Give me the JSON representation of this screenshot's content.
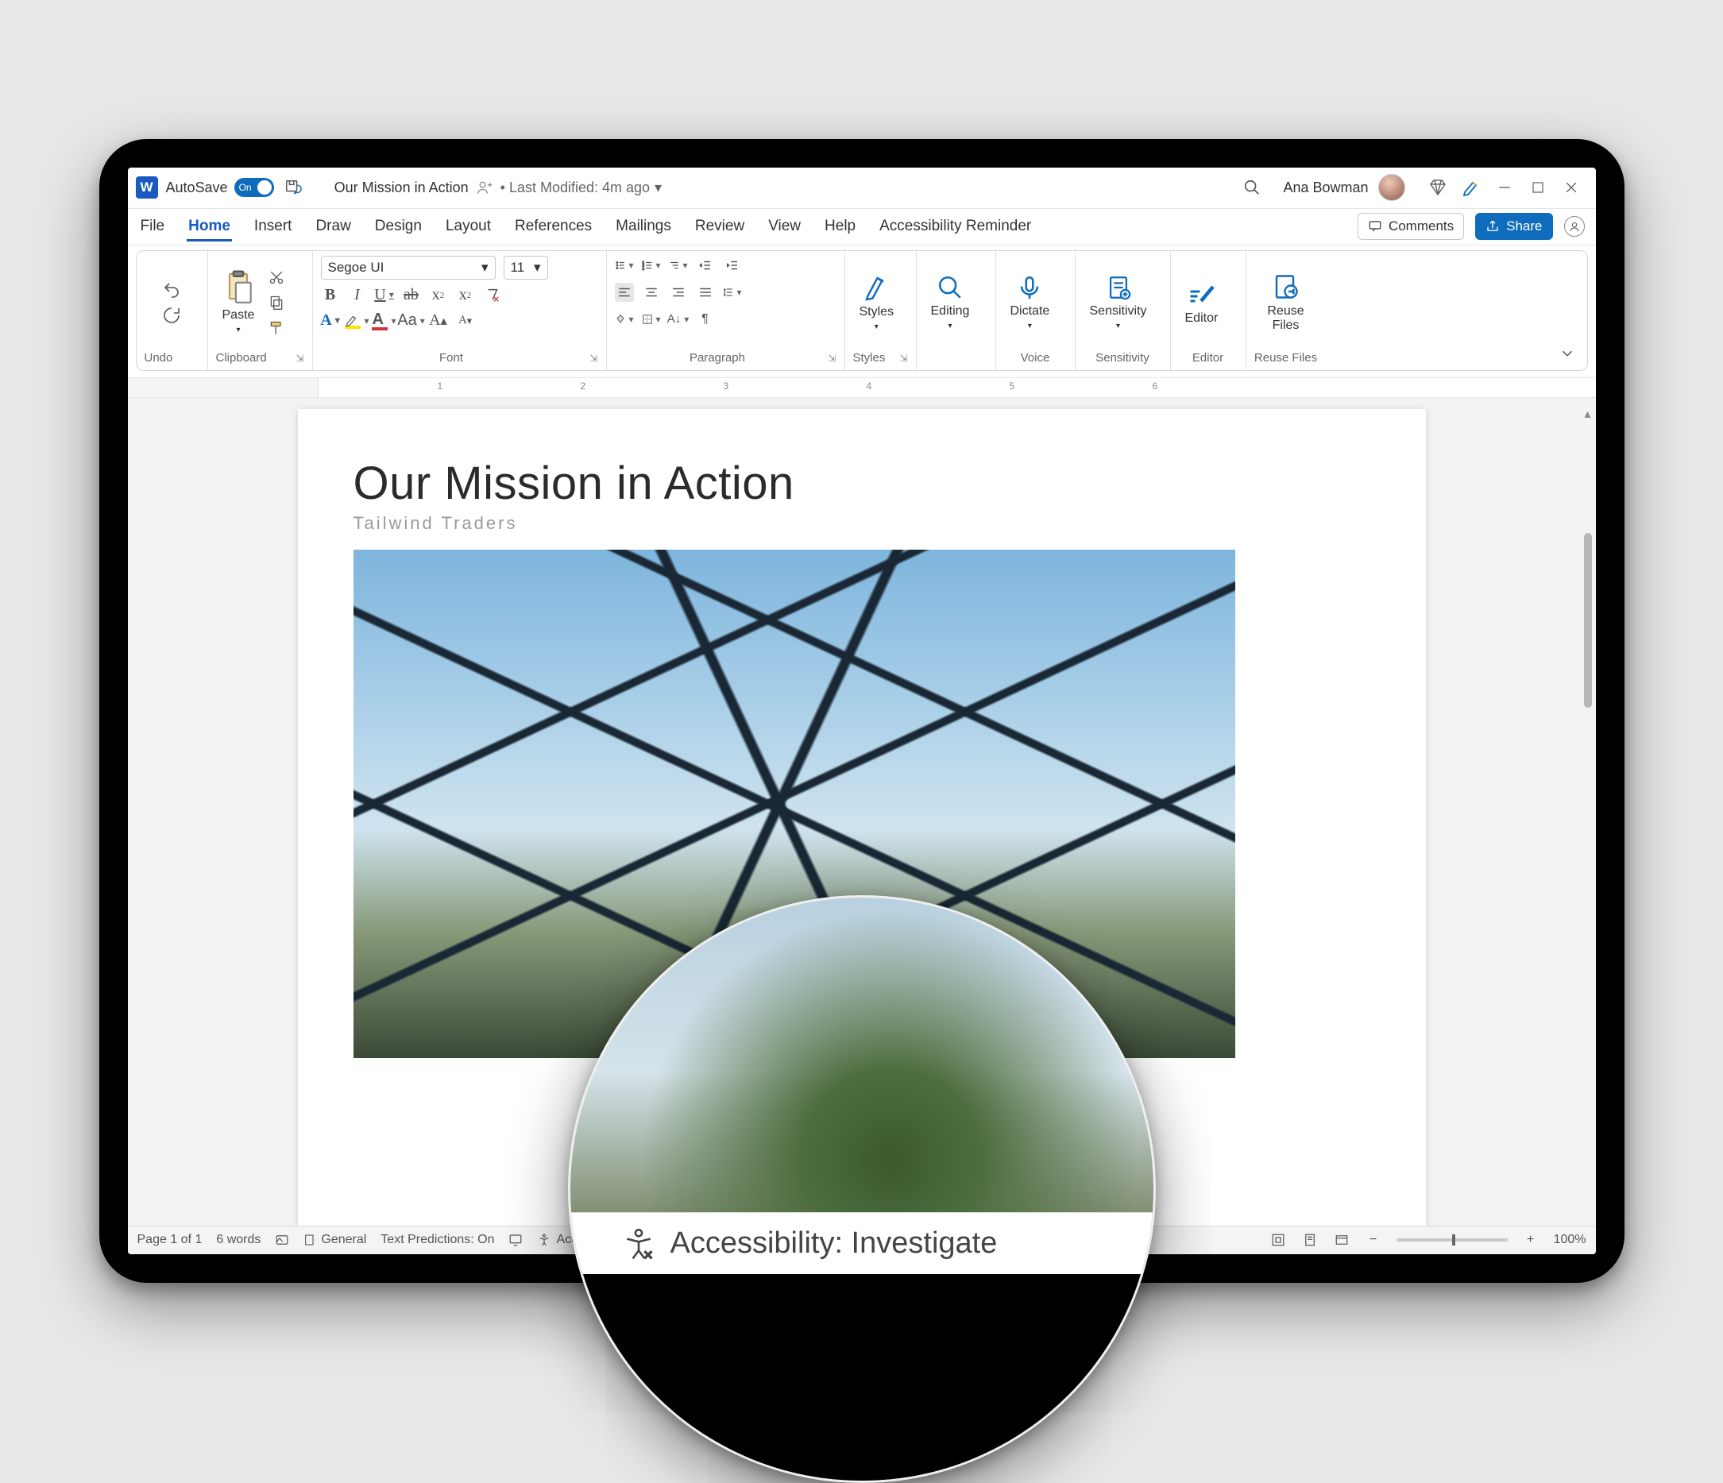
{
  "titlebar": {
    "autosave_label": "AutoSave",
    "autosave_state": "On",
    "doc_title": "Our Mission in Action",
    "last_modified": "• Last Modified: 4m ago",
    "user_name": "Ana Bowman"
  },
  "tabs": {
    "file": "File",
    "home": "Home",
    "insert": "Insert",
    "draw": "Draw",
    "design": "Design",
    "layout": "Layout",
    "references": "References",
    "mailings": "Mailings",
    "review": "Review",
    "view": "View",
    "help": "Help",
    "accessibility_reminder": "Accessibility Reminder",
    "comments": "Comments",
    "share": "Share"
  },
  "ribbon": {
    "undo_group": "Undo",
    "clipboard_group": "Clipboard",
    "paste": "Paste",
    "font_group": "Font",
    "font_name": "Segoe UI",
    "font_size": "11",
    "paragraph_group": "Paragraph",
    "styles_group": "Styles",
    "styles": "Styles",
    "editing": "Editing",
    "voice_group": "Voice",
    "dictate": "Dictate",
    "sensitivity_group": "Sensitivity",
    "sensitivity": "Sensitivity",
    "editor_group": "Editor",
    "editor": "Editor",
    "reuse_group": "Reuse Files",
    "reuse": "Reuse Files"
  },
  "ruler_numbers": [
    "1",
    "2",
    "3",
    "4",
    "5",
    "6"
  ],
  "document": {
    "heading": "Our Mission in Action",
    "subheading": "Tailwind Traders"
  },
  "status": {
    "page": "Page 1 of 1",
    "words": "6 words",
    "general": "General",
    "predictions": "Text Predictions: On",
    "accessibility_short": "Acc",
    "zoom": "100%"
  },
  "magnifier": {
    "text": "Accessibility: Investigate"
  }
}
